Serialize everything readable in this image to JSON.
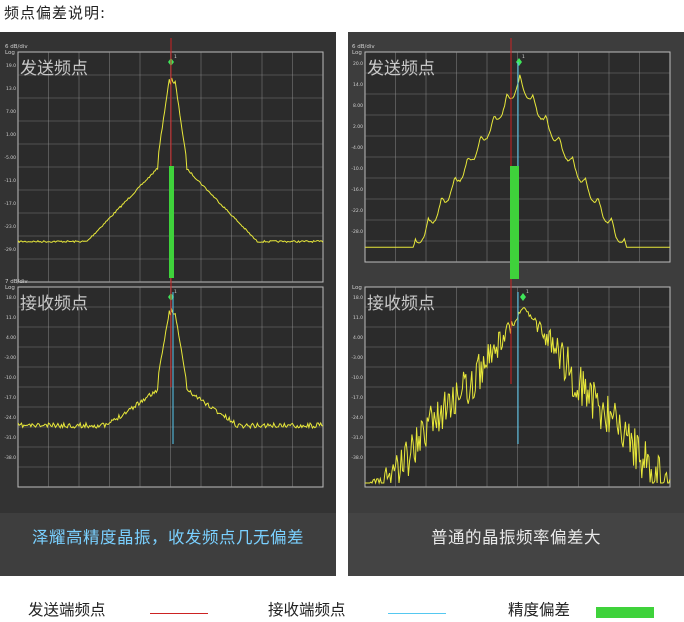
{
  "heading": "频点偏差说明:",
  "colors": {
    "transmit": "#cc2222",
    "receive": "#55c8f0",
    "deviation": "#3fd23b",
    "trace": "#e8e83a",
    "grid": "#9a9a9a"
  },
  "left": {
    "caption": "泽耀高精度晶振，收发频点几无偏差",
    "top_plot": {
      "label": "发送频点",
      "scale": "6 dB/div",
      "log": "Log",
      "marker": "1",
      "ticks": [
        "19.0",
        "13.0",
        "7.00",
        "1.00",
        "-5.00",
        "-11.0",
        "-17.0",
        "-23.0",
        "-29.0"
      ]
    },
    "bottom_plot": {
      "label": "接收频点",
      "scale": "7 dB/div",
      "log": "Log",
      "marker": "1",
      "ticks": [
        "18.0",
        "11.0",
        "4.00",
        "-3.00",
        "-10.0",
        "-17.0",
        "-24.0",
        "-31.0",
        "-38.0"
      ]
    }
  },
  "right": {
    "caption": "普通的晶振频率偏差大",
    "top_plot": {
      "label": "发送频点",
      "scale": "6 dB/div",
      "log": "Log",
      "marker": "1",
      "ticks": [
        "20.0",
        "14.0",
        "8.00",
        "2.00",
        "-4.00",
        "-10.0",
        "-16.0",
        "-22.0",
        "-28.0"
      ]
    },
    "bottom_plot": {
      "label": "接收频点",
      "scale": "",
      "log": "Log",
      "marker": "1",
      "ticks": [
        "18.0",
        "11.0",
        "4.00",
        "-3.00",
        "-10.0",
        "-17.0",
        "-24.0",
        "-31.0",
        "-38.0"
      ]
    }
  },
  "legend": {
    "transmit": "发送端频点",
    "receive": "接收端频点",
    "deviation": "精度偏差"
  }
}
